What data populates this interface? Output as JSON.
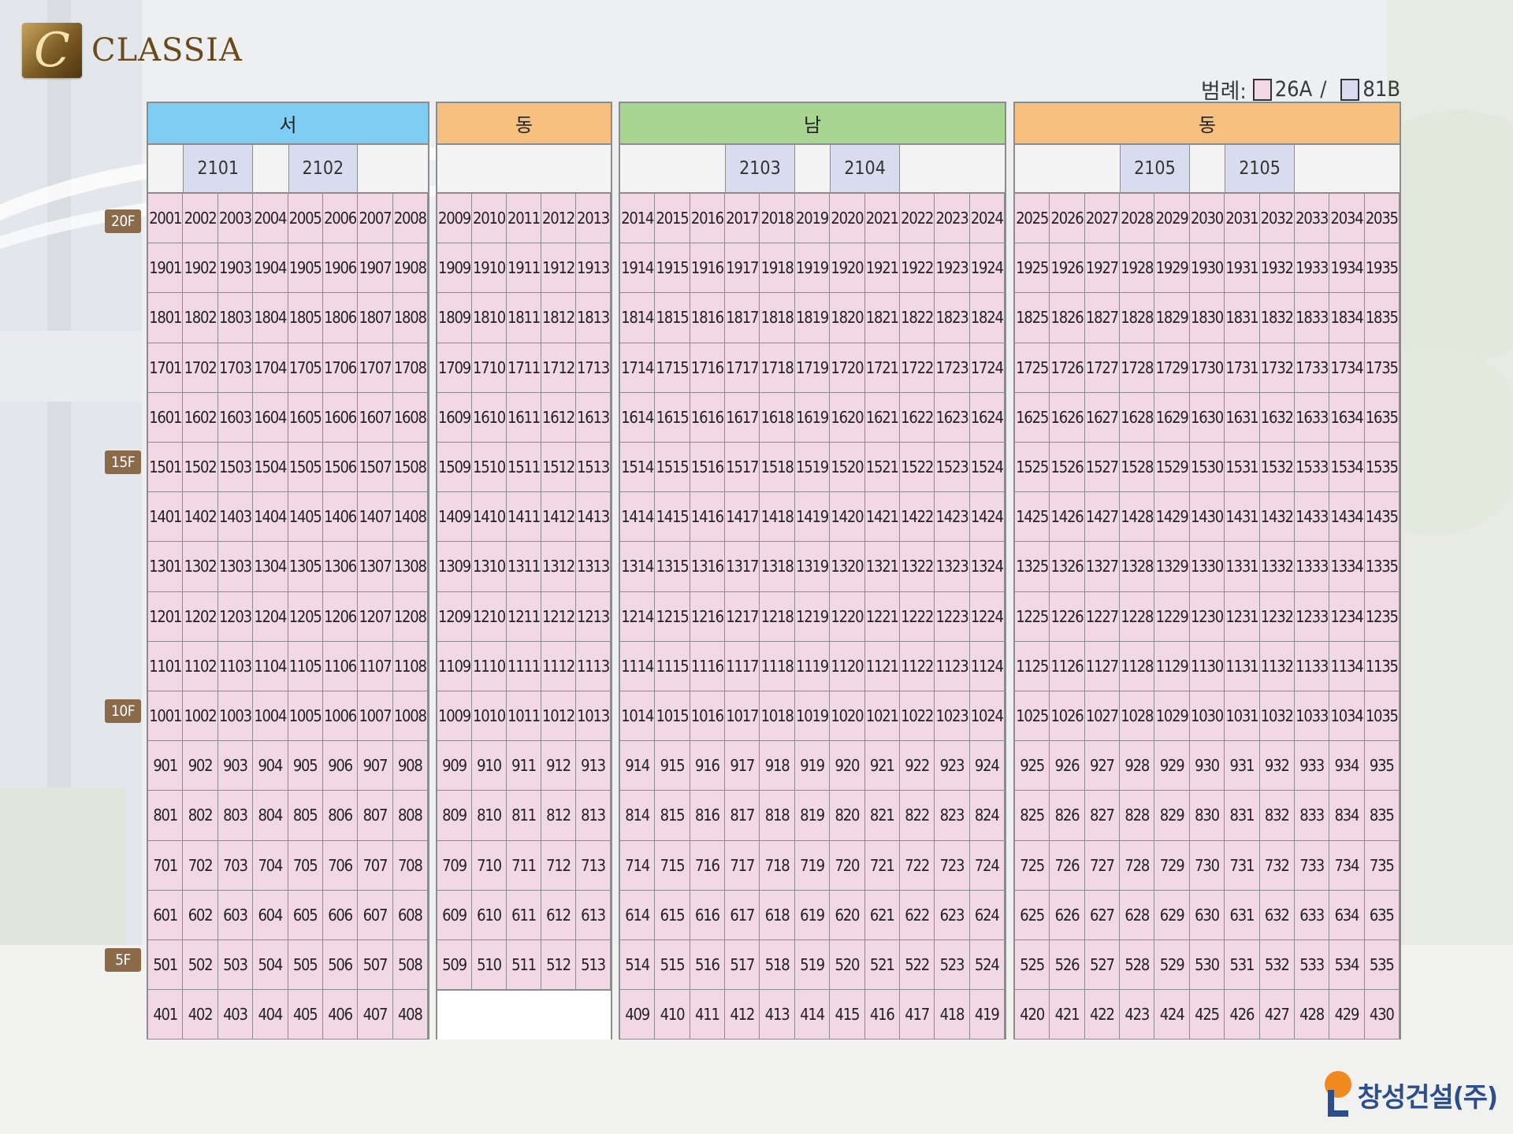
{
  "logo": {
    "brand": "CLASSIA",
    "mark_glyph": "C"
  },
  "legend": {
    "label": "범례:",
    "item1": "26A",
    "item2": "81B",
    "separator": "/"
  },
  "floors": [
    {
      "label": "20F",
      "floor": 20
    },
    {
      "label": "15F",
      "floor": 15
    },
    {
      "label": "10F",
      "floor": 10
    },
    {
      "label": "5F",
      "floor": 5
    }
  ],
  "blocks": [
    {
      "direction": "서",
      "color": "#7fcdf2",
      "cols": 8,
      "buildings": [
        {
          "name": "2101",
          "span": [
            1,
            3
          ]
        },
        {
          "name": "2102",
          "span": [
            4,
            6
          ]
        }
      ],
      "units": {
        "20": [
          2001,
          2002,
          2003,
          2004,
          2005,
          2006,
          2007,
          2008
        ],
        "19": [
          1901,
          1902,
          1903,
          1904,
          1905,
          1906,
          1907,
          1908
        ],
        "18": [
          1801,
          1802,
          1803,
          1804,
          1805,
          1806,
          1807,
          1808
        ],
        "17": [
          1701,
          1702,
          1703,
          1704,
          1705,
          1706,
          1707,
          1708
        ],
        "16": [
          1601,
          1602,
          1603,
          1604,
          1605,
          1606,
          1607,
          1608
        ],
        "15": [
          1501,
          1502,
          1503,
          1504,
          1505,
          1506,
          1507,
          1508
        ],
        "14": [
          1401,
          1402,
          1403,
          1404,
          1405,
          1406,
          1407,
          1408
        ],
        "13": [
          1301,
          1302,
          1303,
          1304,
          1305,
          1306,
          1307,
          1308
        ],
        "12": [
          1201,
          1202,
          1203,
          1204,
          1205,
          1206,
          1207,
          1208
        ],
        "11": [
          1101,
          1102,
          1103,
          1104,
          1105,
          1106,
          1107,
          1108
        ],
        "10": [
          1001,
          1002,
          1003,
          1004,
          1005,
          1006,
          1007,
          1008
        ],
        "9": [
          901,
          902,
          903,
          904,
          905,
          906,
          907,
          908
        ],
        "8": [
          801,
          802,
          803,
          804,
          805,
          806,
          807,
          808
        ],
        "7": [
          701,
          702,
          703,
          704,
          705,
          706,
          707,
          708
        ],
        "6": [
          601,
          602,
          603,
          604,
          605,
          606,
          607,
          608
        ],
        "5": [
          501,
          502,
          503,
          504,
          505,
          506,
          507,
          508
        ],
        "4": [
          401,
          402,
          403,
          404,
          405,
          406,
          407,
          408
        ]
      }
    },
    {
      "direction": "동",
      "color": "#f8c07f",
      "cols": 5,
      "buildings": [],
      "units": {
        "20": [
          2009,
          2010,
          2011,
          2012,
          2013
        ],
        "19": [
          1909,
          1910,
          1911,
          1912,
          1913
        ],
        "18": [
          1809,
          1810,
          1811,
          1812,
          1813
        ],
        "17": [
          1709,
          1710,
          1711,
          1712,
          1713
        ],
        "16": [
          1609,
          1610,
          1611,
          1612,
          1613
        ],
        "15": [
          1509,
          1510,
          1511,
          1512,
          1513
        ],
        "14": [
          1409,
          1410,
          1411,
          1412,
          1413
        ],
        "13": [
          1309,
          1310,
          1311,
          1312,
          1313
        ],
        "12": [
          1209,
          1210,
          1211,
          1212,
          1213
        ],
        "11": [
          1109,
          1110,
          1111,
          1112,
          1113
        ],
        "10": [
          1009,
          1010,
          1011,
          1012,
          1013
        ],
        "9": [
          909,
          910,
          911,
          912,
          913
        ],
        "8": [
          809,
          810,
          811,
          812,
          813
        ],
        "7": [
          709,
          710,
          711,
          712,
          713
        ],
        "6": [
          609,
          610,
          611,
          612,
          613
        ],
        "5": [
          509,
          510,
          511,
          512,
          513
        ]
      }
    },
    {
      "direction": "남",
      "color": "#a9d593",
      "cols": 11,
      "buildings": [
        {
          "name": "2103",
          "span": [
            3,
            5
          ]
        },
        {
          "name": "2104",
          "span": [
            6,
            8
          ]
        }
      ],
      "units": {
        "20": [
          2014,
          2015,
          2016,
          2017,
          2018,
          2019,
          2020,
          2021,
          2022,
          2023,
          2024
        ],
        "19": [
          1914,
          1915,
          1916,
          1917,
          1918,
          1919,
          1920,
          1921,
          1922,
          1923,
          1924
        ],
        "18": [
          1814,
          1815,
          1816,
          1817,
          1818,
          1819,
          1820,
          1821,
          1822,
          1823,
          1824
        ],
        "17": [
          1714,
          1715,
          1716,
          1717,
          1718,
          1719,
          1720,
          1721,
          1722,
          1723,
          1724
        ],
        "16": [
          1614,
          1615,
          1616,
          1617,
          1618,
          1619,
          1620,
          1621,
          1622,
          1623,
          1624
        ],
        "15": [
          1514,
          1515,
          1516,
          1517,
          1518,
          1519,
          1520,
          1521,
          1522,
          1523,
          1524
        ],
        "14": [
          1414,
          1415,
          1416,
          1417,
          1418,
          1419,
          1420,
          1421,
          1422,
          1423,
          1424
        ],
        "13": [
          1314,
          1315,
          1316,
          1317,
          1318,
          1319,
          1320,
          1321,
          1322,
          1323,
          1324
        ],
        "12": [
          1214,
          1215,
          1216,
          1217,
          1218,
          1219,
          1220,
          1221,
          1222,
          1223,
          1224
        ],
        "11": [
          1114,
          1115,
          1116,
          1117,
          1118,
          1119,
          1120,
          1121,
          1122,
          1123,
          1124
        ],
        "10": [
          1014,
          1015,
          1016,
          1017,
          1018,
          1019,
          1020,
          1021,
          1022,
          1023,
          1024
        ],
        "9": [
          914,
          915,
          916,
          917,
          918,
          919,
          920,
          921,
          922,
          923,
          924
        ],
        "8": [
          814,
          815,
          816,
          817,
          818,
          819,
          820,
          821,
          822,
          823,
          824
        ],
        "7": [
          714,
          715,
          716,
          717,
          718,
          719,
          720,
          721,
          722,
          723,
          724
        ],
        "6": [
          614,
          615,
          616,
          617,
          618,
          619,
          620,
          621,
          622,
          623,
          624
        ],
        "5": [
          514,
          515,
          516,
          517,
          518,
          519,
          520,
          521,
          522,
          523,
          524
        ],
        "4": [
          409,
          410,
          411,
          412,
          413,
          414,
          415,
          416,
          417,
          418,
          419
        ]
      }
    },
    {
      "direction": "동",
      "color": "#f8c07f",
      "cols": 11,
      "buildings": [
        {
          "name": "2105",
          "span": [
            3,
            5
          ]
        },
        {
          "name": "2105",
          "span": [
            6,
            8
          ]
        }
      ],
      "units": {
        "20": [
          2025,
          2026,
          2027,
          2028,
          2029,
          2030,
          2031,
          2032,
          2033,
          2034,
          2035
        ],
        "19": [
          1925,
          1926,
          1927,
          1928,
          1929,
          1930,
          1931,
          1932,
          1933,
          1934,
          1935
        ],
        "18": [
          1825,
          1826,
          1827,
          1828,
          1829,
          1830,
          1831,
          1832,
          1833,
          1834,
          1835
        ],
        "17": [
          1725,
          1726,
          1727,
          1728,
          1729,
          1730,
          1731,
          1732,
          1733,
          1734,
          1735
        ],
        "16": [
          1625,
          1626,
          1627,
          1628,
          1629,
          1630,
          1631,
          1632,
          1633,
          1634,
          1635
        ],
        "15": [
          1525,
          1526,
          1527,
          1528,
          1529,
          1530,
          1531,
          1532,
          1533,
          1534,
          1535
        ],
        "14": [
          1425,
          1426,
          1427,
          1428,
          1429,
          1430,
          1431,
          1432,
          1433,
          1434,
          1435
        ],
        "13": [
          1325,
          1326,
          1327,
          1328,
          1329,
          1330,
          1331,
          1332,
          1333,
          1334,
          1335
        ],
        "12": [
          1225,
          1226,
          1227,
          1228,
          1229,
          1230,
          1231,
          1232,
          1233,
          1234,
          1235
        ],
        "11": [
          1125,
          1126,
          1127,
          1128,
          1129,
          1130,
          1131,
          1132,
          1133,
          1134,
          1135
        ],
        "10": [
          1025,
          1026,
          1027,
          1028,
          1029,
          1030,
          1031,
          1032,
          1033,
          1034,
          1035
        ],
        "9": [
          925,
          926,
          927,
          928,
          929,
          930,
          931,
          932,
          933,
          934,
          935
        ],
        "8": [
          825,
          826,
          827,
          828,
          829,
          830,
          831,
          832,
          833,
          834,
          835
        ],
        "7": [
          725,
          726,
          727,
          728,
          729,
          730,
          731,
          732,
          733,
          734,
          735
        ],
        "6": [
          625,
          626,
          627,
          628,
          629,
          630,
          631,
          632,
          633,
          634,
          635
        ],
        "5": [
          525,
          526,
          527,
          528,
          529,
          530,
          531,
          532,
          533,
          534,
          535
        ],
        "4": [
          420,
          421,
          422,
          423,
          424,
          425,
          426,
          427,
          428,
          429,
          430
        ]
      }
    }
  ],
  "company": {
    "name": "창성건설(주)"
  },
  "colors": {
    "unit_fill": "#f2d7e5",
    "building_fill": "#d8dcee",
    "floor_badge": "#8a6a48",
    "grid_line": "#8c8c8c"
  }
}
